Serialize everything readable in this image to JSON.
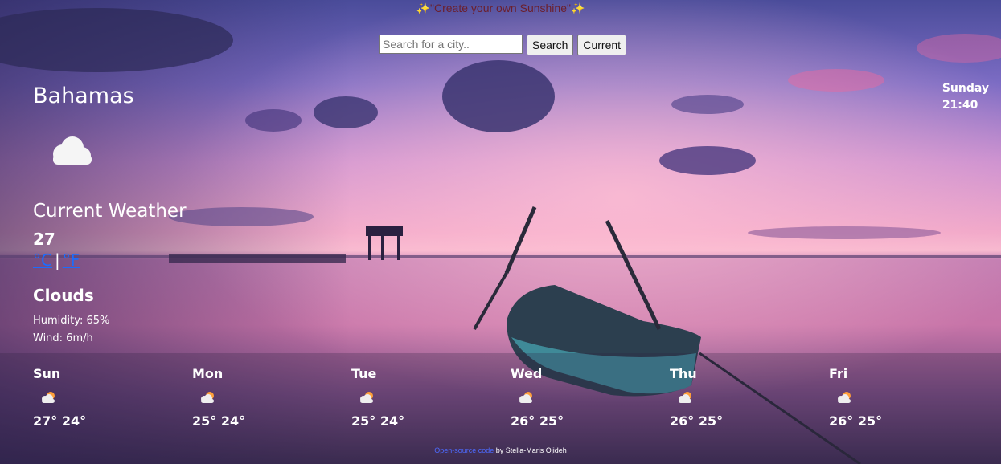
{
  "header": {
    "quote": "✨\"Create your own Sunshine\"✨"
  },
  "search": {
    "placeholder": "Search for a city..",
    "search_label": "Search",
    "current_label": "Current"
  },
  "current": {
    "city": "Bahamas",
    "day": "Sunday",
    "time": "21:40",
    "title": "Current Weather",
    "temperature": "27",
    "unit_c": "°C",
    "unit_separator": "|",
    "unit_f": "°F",
    "description": "Clouds",
    "humidity": "Humidity: 65%",
    "wind": "Wind: 6m/h",
    "icon": "cloud-icon"
  },
  "forecast": [
    {
      "day": "Sun",
      "temps": "27° 24°",
      "icon": "sun-behind-cloud-icon"
    },
    {
      "day": "Mon",
      "temps": "25° 24°",
      "icon": "sun-behind-cloud-icon"
    },
    {
      "day": "Tue",
      "temps": "25° 24°",
      "icon": "sun-behind-cloud-icon"
    },
    {
      "day": "Wed",
      "temps": "26° 25°",
      "icon": "sun-behind-cloud-icon"
    },
    {
      "day": "Thu",
      "temps": "26° 25°",
      "icon": "sun-behind-cloud-icon"
    },
    {
      "day": "Fri",
      "temps": "26° 25°",
      "icon": "sun-behind-cloud-icon"
    }
  ],
  "footer": {
    "link_text": "Open-source code",
    "author_text": "by Stella-Maris Ojideh"
  },
  "colors": {
    "quote": "#6b1f2c",
    "unit_link": "#1a6dff",
    "footer_link": "#4d6bff"
  }
}
